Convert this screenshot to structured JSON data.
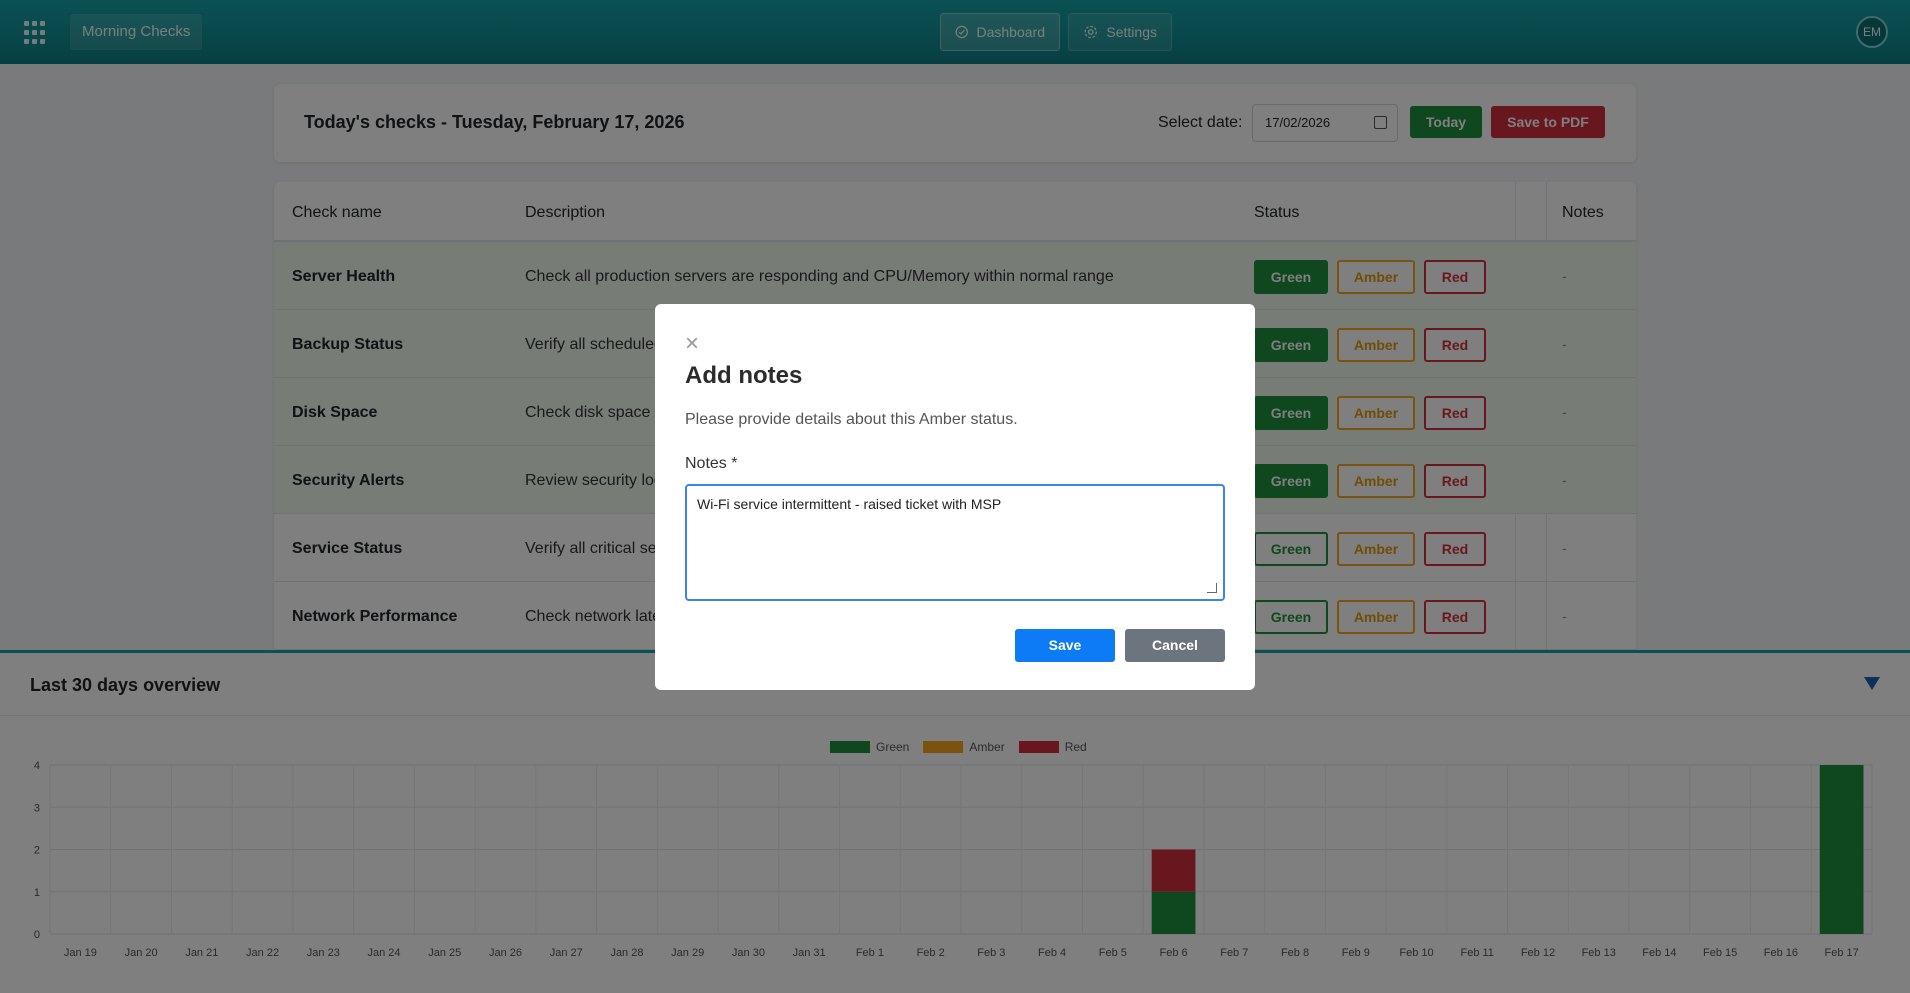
{
  "topbar": {
    "app_name": "Morning Checks",
    "nav": {
      "dashboard": "Dashboard",
      "settings": "Settings"
    },
    "avatar_initials": "EM"
  },
  "header": {
    "title": "Today's checks - Tuesday, February 17, 2026",
    "date_label": "Select date:",
    "date_value": "17/02/2026",
    "today_label": "Today",
    "pdf_label": "Save to PDF"
  },
  "table": {
    "columns": [
      "Check name",
      "Description",
      "Status",
      "Notes"
    ],
    "status_labels": {
      "green": "Green",
      "amber": "Amber",
      "red": "Red"
    },
    "rows": [
      {
        "name": "Server Health",
        "description": "Check all production servers are responding and CPU/Memory within normal range",
        "notes": "-"
      },
      {
        "name": "Backup Status",
        "description": "Verify all scheduled",
        "notes": "-"
      },
      {
        "name": "Disk Space",
        "description": "Check disk space o",
        "notes": "-"
      },
      {
        "name": "Security Alerts",
        "description": "Review security log",
        "notes": "-"
      },
      {
        "name": "Service Status",
        "description": "Verify all critical se",
        "notes": "-"
      },
      {
        "name": "Network Performance",
        "description": "Check network late",
        "notes": "-"
      }
    ]
  },
  "overview": {
    "title": "Last 30 days overview"
  },
  "modal": {
    "close_glyph": "×",
    "title": "Add notes",
    "subtitle": "Please provide details about this Amber status.",
    "label": "Notes *",
    "notes_value": "Wi-Fi service intermittent - raised ticket with MSP",
    "save_label": "Save",
    "cancel_label": "Cancel"
  },
  "colors": {
    "green": "#1e8e3e",
    "amber": "#f5a623",
    "red": "#d32f3f",
    "teal": "#16a3a8"
  },
  "chart_data": {
    "type": "bar",
    "stacked": true,
    "categories": [
      "Jan 19",
      "Jan 20",
      "Jan 21",
      "Jan 22",
      "Jan 23",
      "Jan 24",
      "Jan 25",
      "Jan 26",
      "Jan 27",
      "Jan 28",
      "Jan 29",
      "Jan 30",
      "Jan 31",
      "Feb 1",
      "Feb 2",
      "Feb 3",
      "Feb 4",
      "Feb 5",
      "Feb 6",
      "Feb 7",
      "Feb 8",
      "Feb 9",
      "Feb 10",
      "Feb 11",
      "Feb 12",
      "Feb 13",
      "Feb 14",
      "Feb 15",
      "Feb 16",
      "Feb 17"
    ],
    "series": [
      {
        "name": "Green",
        "color": "#1e8e3e",
        "values": [
          0,
          0,
          0,
          0,
          0,
          0,
          0,
          0,
          0,
          0,
          0,
          0,
          0,
          0,
          0,
          0,
          0,
          0,
          1,
          0,
          0,
          0,
          0,
          0,
          0,
          0,
          0,
          0,
          0,
          4
        ]
      },
      {
        "name": "Amber",
        "color": "#f5a623",
        "values": [
          0,
          0,
          0,
          0,
          0,
          0,
          0,
          0,
          0,
          0,
          0,
          0,
          0,
          0,
          0,
          0,
          0,
          0,
          0,
          0,
          0,
          0,
          0,
          0,
          0,
          0,
          0,
          0,
          0,
          0
        ]
      },
      {
        "name": "Red",
        "color": "#d32f3f",
        "values": [
          0,
          0,
          0,
          0,
          0,
          0,
          0,
          0,
          0,
          0,
          0,
          0,
          0,
          0,
          0,
          0,
          0,
          0,
          1,
          0,
          0,
          0,
          0,
          0,
          0,
          0,
          0,
          0,
          0,
          0
        ]
      }
    ],
    "yticks": [
      0,
      1,
      2,
      3,
      4
    ],
    "ylim": [
      0,
      4
    ],
    "grid": true,
    "legend": "top-center"
  }
}
